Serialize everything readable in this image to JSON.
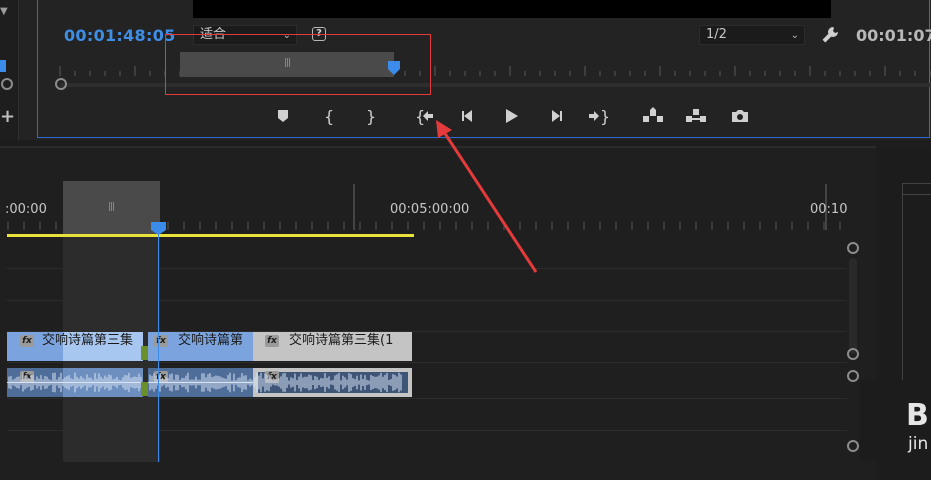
{
  "monitor": {
    "timecode_current": "00:01:48:05",
    "fit_select": "适合",
    "quality_select": "1/2",
    "timecode_duration": "00:01:07",
    "help_icon": "?",
    "icons": [
      "marker-icon",
      "mark-in-icon",
      "mark-out-icon",
      "go-to-in-icon",
      "step-back-icon",
      "play-icon",
      "step-forward-icon",
      "go-to-out-icon",
      "lift-icon",
      "extract-icon",
      "camera-icon"
    ]
  },
  "timeline": {
    "ruler_labels": [
      ":00:00",
      "00:05:00:00",
      "00:10"
    ],
    "video_clips": [
      {
        "title": "交响诗篇第三集"
      },
      {
        "title": "交响诗篇第"
      },
      {
        "title": "交响诗篇第三集(1"
      }
    ]
  },
  "right_panel": {
    "logo_big": "B",
    "logo_small": "jin"
  },
  "colors": {
    "accent": "#3b8cea",
    "highlight": "#e33b3b",
    "work_area": "#e8e23a",
    "clip_blue": "#7ba3de",
    "clip_gray": "#c4c4c4"
  }
}
